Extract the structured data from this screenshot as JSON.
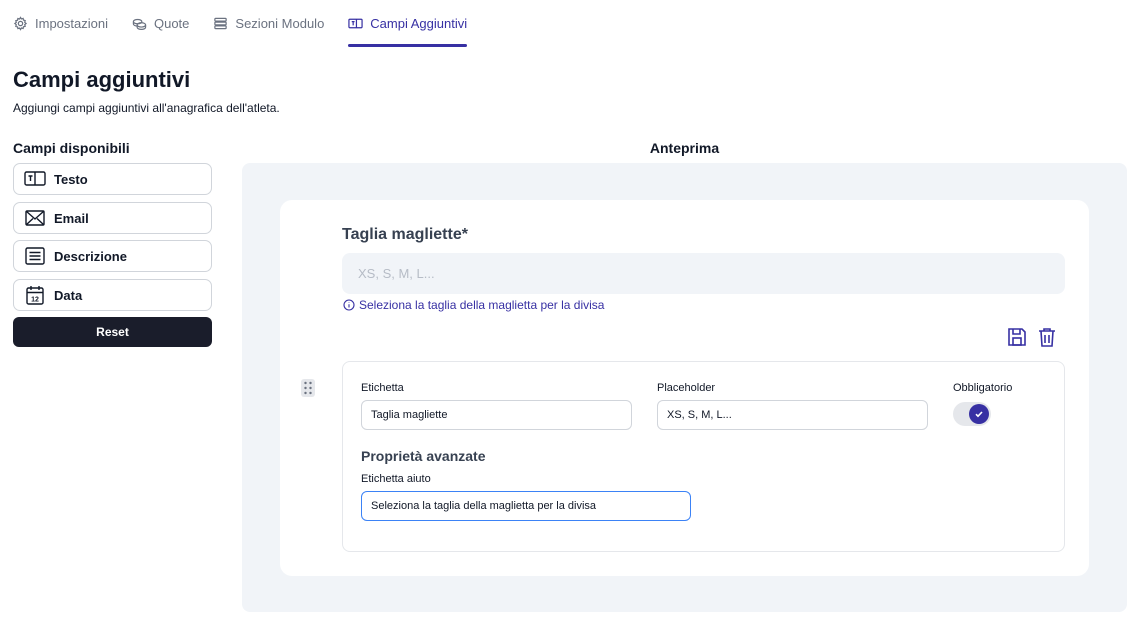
{
  "tabs": [
    {
      "label": "Impostazioni",
      "icon": "gear-icon"
    },
    {
      "label": "Quote",
      "icon": "coins-icon"
    },
    {
      "label": "Sezioni Modulo",
      "icon": "sections-icon"
    },
    {
      "label": "Campi Aggiuntivi",
      "icon": "form-fields-icon",
      "active": true
    }
  ],
  "page": {
    "title": "Campi aggiuntivi",
    "subtitle": "Aggiungi campi aggiuntivi all'anagrafica dell'atleta."
  },
  "available_fields": {
    "heading": "Campi disponibili",
    "items": [
      {
        "label": "Testo",
        "icon": "text-field-icon"
      },
      {
        "label": "Email",
        "icon": "envelope-icon"
      },
      {
        "label": "Descrizione",
        "icon": "description-icon"
      },
      {
        "label": "Data",
        "icon": "calendar-icon"
      }
    ],
    "reset_label": "Reset"
  },
  "preview": {
    "heading": "Anteprima",
    "field": {
      "label": "Taglia magliette*",
      "placeholder": "XS, S, M, L...",
      "help": "Seleziona la taglia della maglietta per la divisa"
    }
  },
  "editor": {
    "label_caption": "Etichetta",
    "label_value": "Taglia magliette",
    "placeholder_caption": "Placeholder",
    "placeholder_value": "XS, S, M, L...",
    "required_caption": "Obbligatorio",
    "required_on": true,
    "advanced_heading": "Proprietà avanzate",
    "help_caption": "Etichetta aiuto",
    "help_value": "Seleziona la taglia della maglietta per la divisa"
  },
  "colors": {
    "accent": "#3730a3",
    "dark_button": "#1a1d2b",
    "panel_bg": "#f1f4f8"
  }
}
